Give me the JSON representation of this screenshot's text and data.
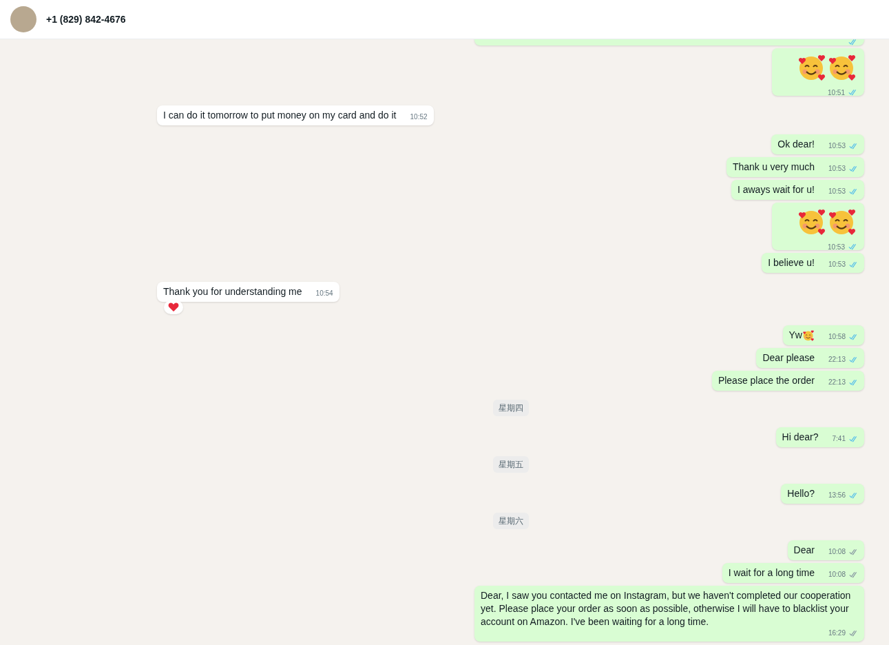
{
  "header": {
    "contact_name": "+1 (829) 842-4676"
  },
  "messages": [
    {
      "kind": "cut",
      "outgoing": true,
      "read": true
    },
    {
      "kind": "emoji",
      "outgoing": true,
      "time": "10:51",
      "read": true
    },
    {
      "kind": "text",
      "outgoing": false,
      "text": "I can do it tomorrow to put money on my card and do it",
      "time": "10:52",
      "reaction": false
    },
    {
      "kind": "text",
      "outgoing": true,
      "text": "Ok dear!",
      "time": "10:53",
      "read": true
    },
    {
      "kind": "text",
      "outgoing": true,
      "text": "Thank u very much",
      "time": "10:53",
      "read": true
    },
    {
      "kind": "text",
      "outgoing": true,
      "text": "I aways wait for u!",
      "time": "10:53",
      "read": true
    },
    {
      "kind": "emoji",
      "outgoing": true,
      "time": "10:53",
      "read": true
    },
    {
      "kind": "text",
      "outgoing": true,
      "text": "I believe u!",
      "time": "10:53",
      "read": true
    },
    {
      "kind": "text",
      "outgoing": false,
      "text": "Thank you for understanding me",
      "time": "10:54",
      "reaction": true
    },
    {
      "kind": "text",
      "outgoing": true,
      "text": "Yw",
      "emoji_suffix": true,
      "time": "10:58",
      "read": true
    },
    {
      "kind": "text",
      "outgoing": true,
      "text": "Dear please",
      "time": "22:13",
      "read": true
    },
    {
      "kind": "text",
      "outgoing": true,
      "text": "Please place the order",
      "time": "22:13",
      "read": true
    },
    {
      "kind": "date",
      "text": "星期四"
    },
    {
      "kind": "text",
      "outgoing": true,
      "text": "Hi dear?",
      "time": "7:41",
      "read": true
    },
    {
      "kind": "date",
      "text": "星期五"
    },
    {
      "kind": "text",
      "outgoing": true,
      "text": "Hello?",
      "time": "13:56",
      "read": true
    },
    {
      "kind": "date",
      "text": "星期六"
    },
    {
      "kind": "text",
      "outgoing": true,
      "text": "Dear",
      "time": "10:08",
      "read": false
    },
    {
      "kind": "text",
      "outgoing": true,
      "text": "I wait for a long time",
      "time": "10:08",
      "read": false
    },
    {
      "kind": "text",
      "outgoing": true,
      "text": "Dear, I saw you contacted me on Instagram, but we haven't completed our cooperation yet. Please place your order as soon as possible, otherwise I will have to blacklist your account on Amazon. I've been waiting for a long time.",
      "time": "16:29",
      "read": false
    }
  ]
}
